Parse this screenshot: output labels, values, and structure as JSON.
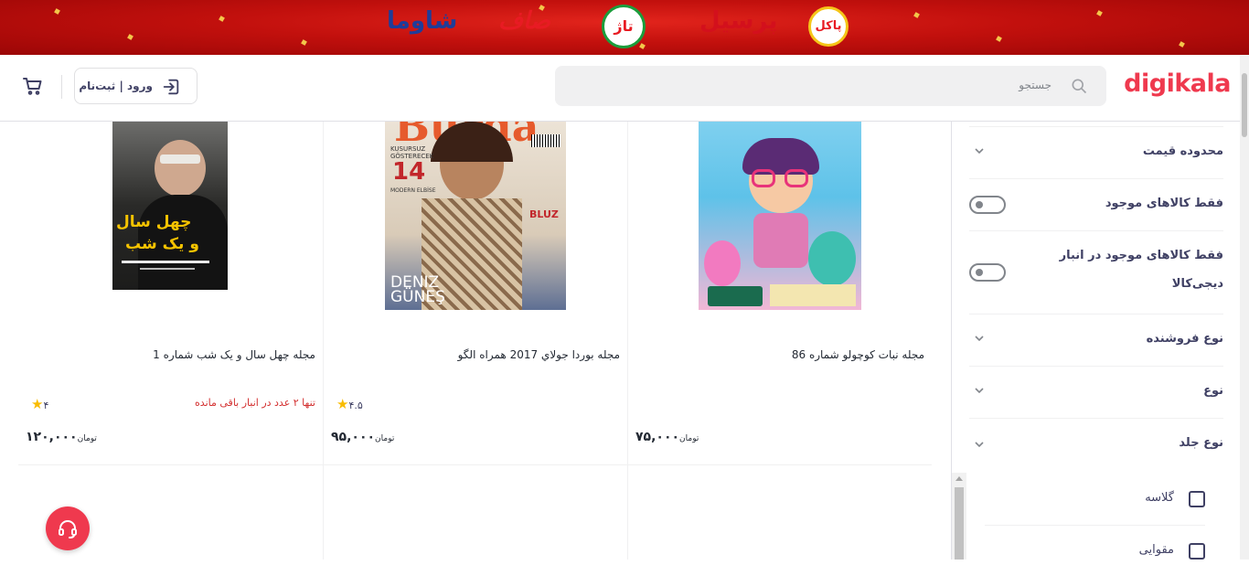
{
  "banner": {
    "brands": [
      "پاکل",
      "پرسیل",
      "تاژ",
      "صاف",
      "شاوما"
    ]
  },
  "header": {
    "logo": "digikala",
    "search_placeholder": "جستجو",
    "login_label": "ورود | ثبت‌نام"
  },
  "products": [
    {
      "title": "مجله نبات کوچولو شماره 86",
      "rating": "",
      "stock_note": "",
      "price": "۷۵,۰۰۰",
      "currency": "تومان"
    },
    {
      "title": "مجله بوردا جولاي 2017 همراه الگو",
      "rating": "۴.۵",
      "stock_note": "",
      "price": "۹۵,۰۰۰",
      "currency": "تومان",
      "cover_text": {
        "masthead": "Burda",
        "line1": "KUSURSUZ",
        "line2": "GÖSTERECEK",
        "big": "14",
        "line3": "MODERN ELBİSE",
        "side1": "BLUZ",
        "bottom": "DENIZ GÜNEŞ"
      }
    },
    {
      "title": "مجله چهل سال و یک شب شماره 1",
      "rating": "۴",
      "stock_note": "تنها ۲ عدد در انبار باقی مانده",
      "price": "۱۲۰,۰۰۰",
      "currency": "تومان",
      "cover_text": {
        "title1": "چهل سال",
        "title2": "و یک شب"
      }
    }
  ],
  "filters": {
    "price_range": "محدوده قیمت",
    "only_available": "فقط کالاهای موجود",
    "only_in_stock_line1": "فقط کالاهای موجود در انبار",
    "only_in_stock_line2": "دیجی‌کالا",
    "seller_type": "نوع فروشنده",
    "type": "نوع",
    "binding_type": "نوع جلد",
    "options": [
      "گلاسه",
      "مقوایی"
    ]
  },
  "colors": {
    "accent": "#ef394e",
    "star": "#f9bc00",
    "warning": "#d32f2f"
  }
}
